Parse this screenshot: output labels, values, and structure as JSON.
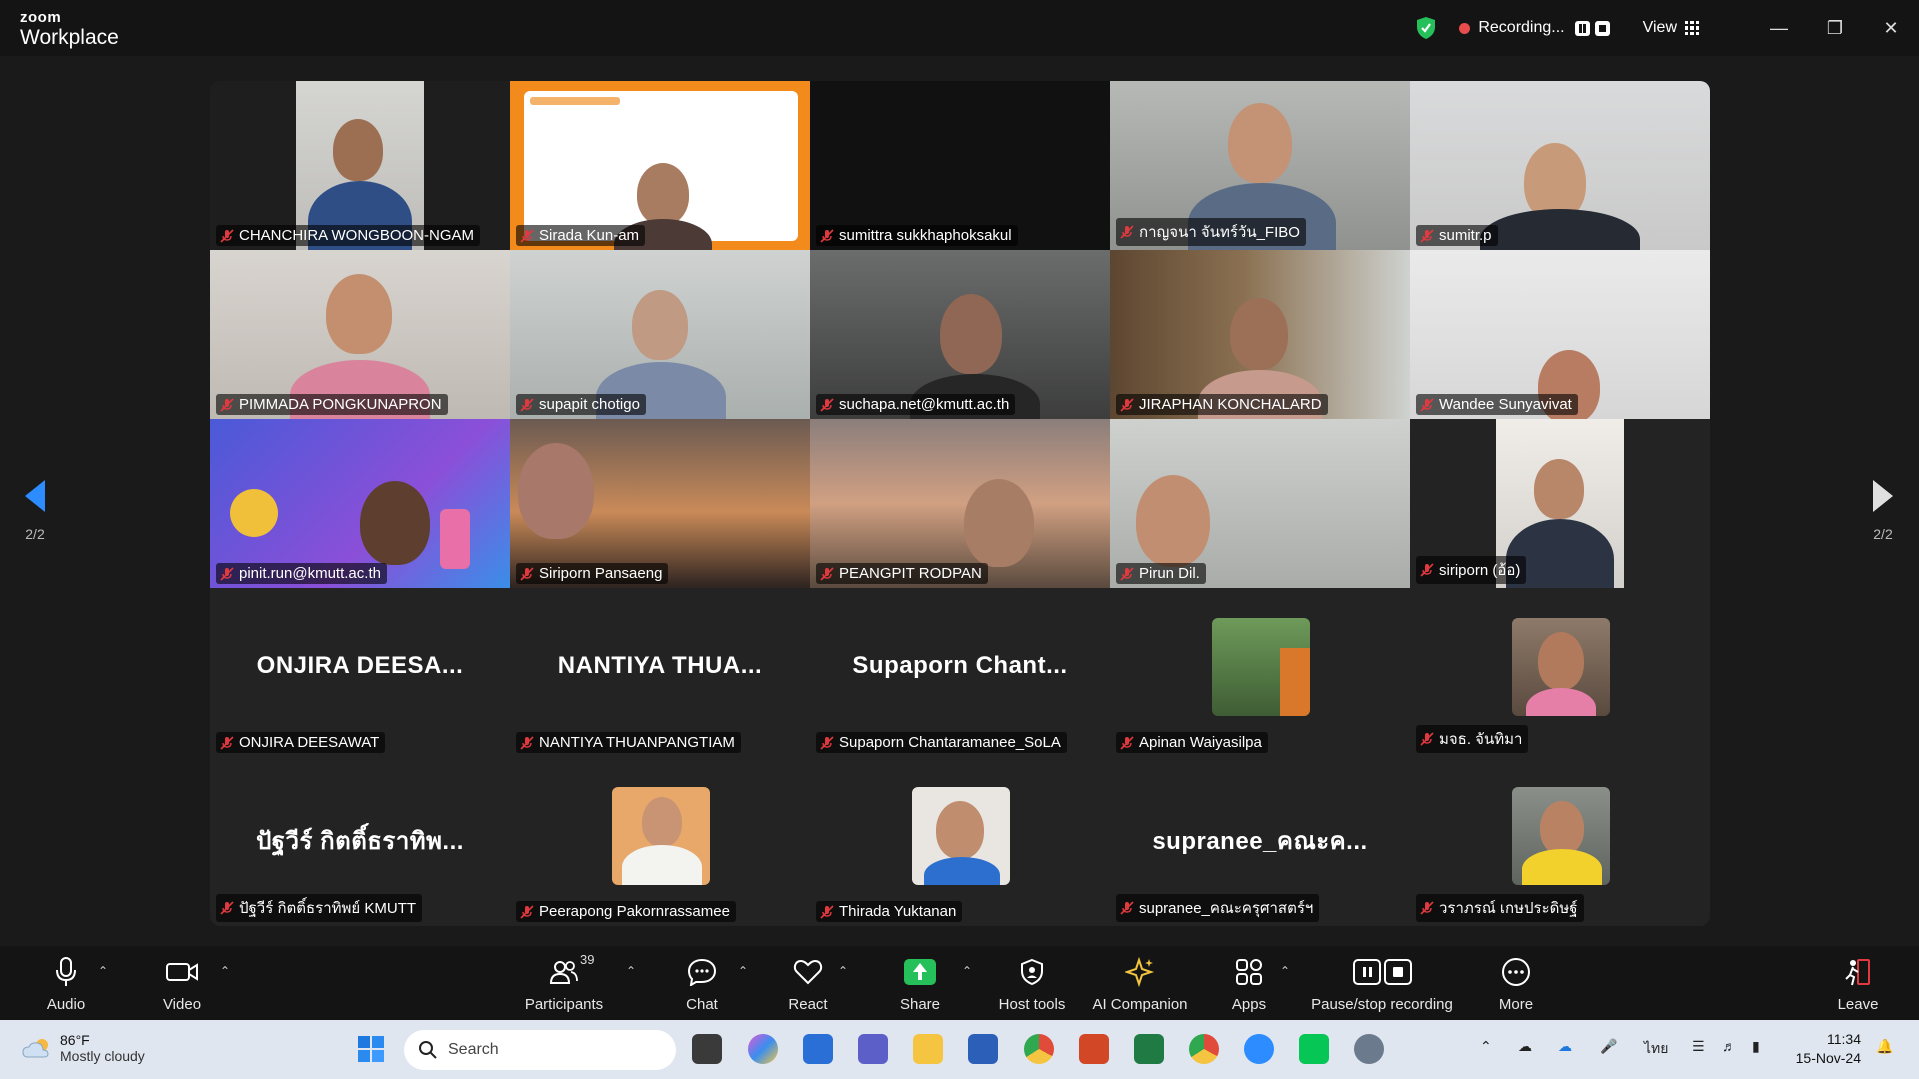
{
  "window": {
    "brand_small": "zoom",
    "brand_large": "Workplace",
    "recording_label": "Recording...",
    "view_label": "View"
  },
  "participants_grid": [
    {
      "name": "CHANCHIRA WONGBOON-NGAM",
      "video": true
    },
    {
      "name": "Sirada Kun-am",
      "video": true
    },
    {
      "name": "sumittra sukkhaphoksakul",
      "video": false
    },
    {
      "name": "กาญจนา จันทร์วัน_FIBO",
      "video": true
    },
    {
      "name": "sumitr.p",
      "video": true
    },
    {
      "name": "PIMMADA PONGKUNAPRON",
      "video": true
    },
    {
      "name": "supapit chotigo",
      "video": true
    },
    {
      "name": "suchapa.net@kmutt.ac.th",
      "video": true
    },
    {
      "name": "JIRAPHAN KONCHALARD",
      "video": true
    },
    {
      "name": "Wandee Sunyavivat",
      "video": true
    },
    {
      "name": "pinit.run@kmutt.ac.th",
      "video": true
    },
    {
      "name": "Siriporn Pansaeng",
      "video": true
    },
    {
      "name": "PEANGPIT RODPAN",
      "video": true
    },
    {
      "name": "Pirun Dil.",
      "video": true
    },
    {
      "name": "siriporn (อ้อ)",
      "video": true
    },
    {
      "name": "ONJIRA DEESAWAT",
      "display": "ONJIRA  DEESA..."
    },
    {
      "name": "NANTIYA THUANPANGTIAM",
      "display": "NANTIYA  THUA..."
    },
    {
      "name": "Supaporn Chantaramanee_SoLA",
      "display": "Supaporn  Chant..."
    },
    {
      "name": "Apinan Waiyasilpa",
      "avatar": true
    },
    {
      "name": "มจธ. จันทิมา",
      "avatar": true
    },
    {
      "name": "ปัฐวีร์ กิตติ์ธราทิพย์ KMUTT",
      "display": "ปัฐวีร์ กิตติ์ธราทิพ..."
    },
    {
      "name": "Peerapong Pakornrassamee",
      "avatar": true
    },
    {
      "name": "Thirada Yuktanan",
      "avatar": true
    },
    {
      "name": "supranee_คณะครุศาสตร์ฯ",
      "display": "supranee_คณะค..."
    },
    {
      "name": "วราภรณ์ เกษประดิษฐ์",
      "avatar": true
    }
  ],
  "pager": {
    "left": "2/2",
    "right": "2/2"
  },
  "toolbar": {
    "audio": "Audio",
    "video": "Video",
    "participants": "Participants",
    "participants_count": "39",
    "chat": "Chat",
    "react": "React",
    "share": "Share",
    "host_tools": "Host tools",
    "ai_companion": "AI Companion",
    "apps": "Apps",
    "pause_stop": "Pause/stop recording",
    "more": "More",
    "leave": "Leave"
  },
  "taskbar": {
    "temp": "86°F",
    "weather": "Mostly cloudy",
    "search_placeholder": "Search",
    "lang": "ไทย",
    "time": "11:34",
    "date": "15-Nov-24"
  },
  "colors": {
    "accent": "#2d8cff",
    "recording": "#e84c4c",
    "share": "#26c05a",
    "muted": "#e0393e"
  }
}
